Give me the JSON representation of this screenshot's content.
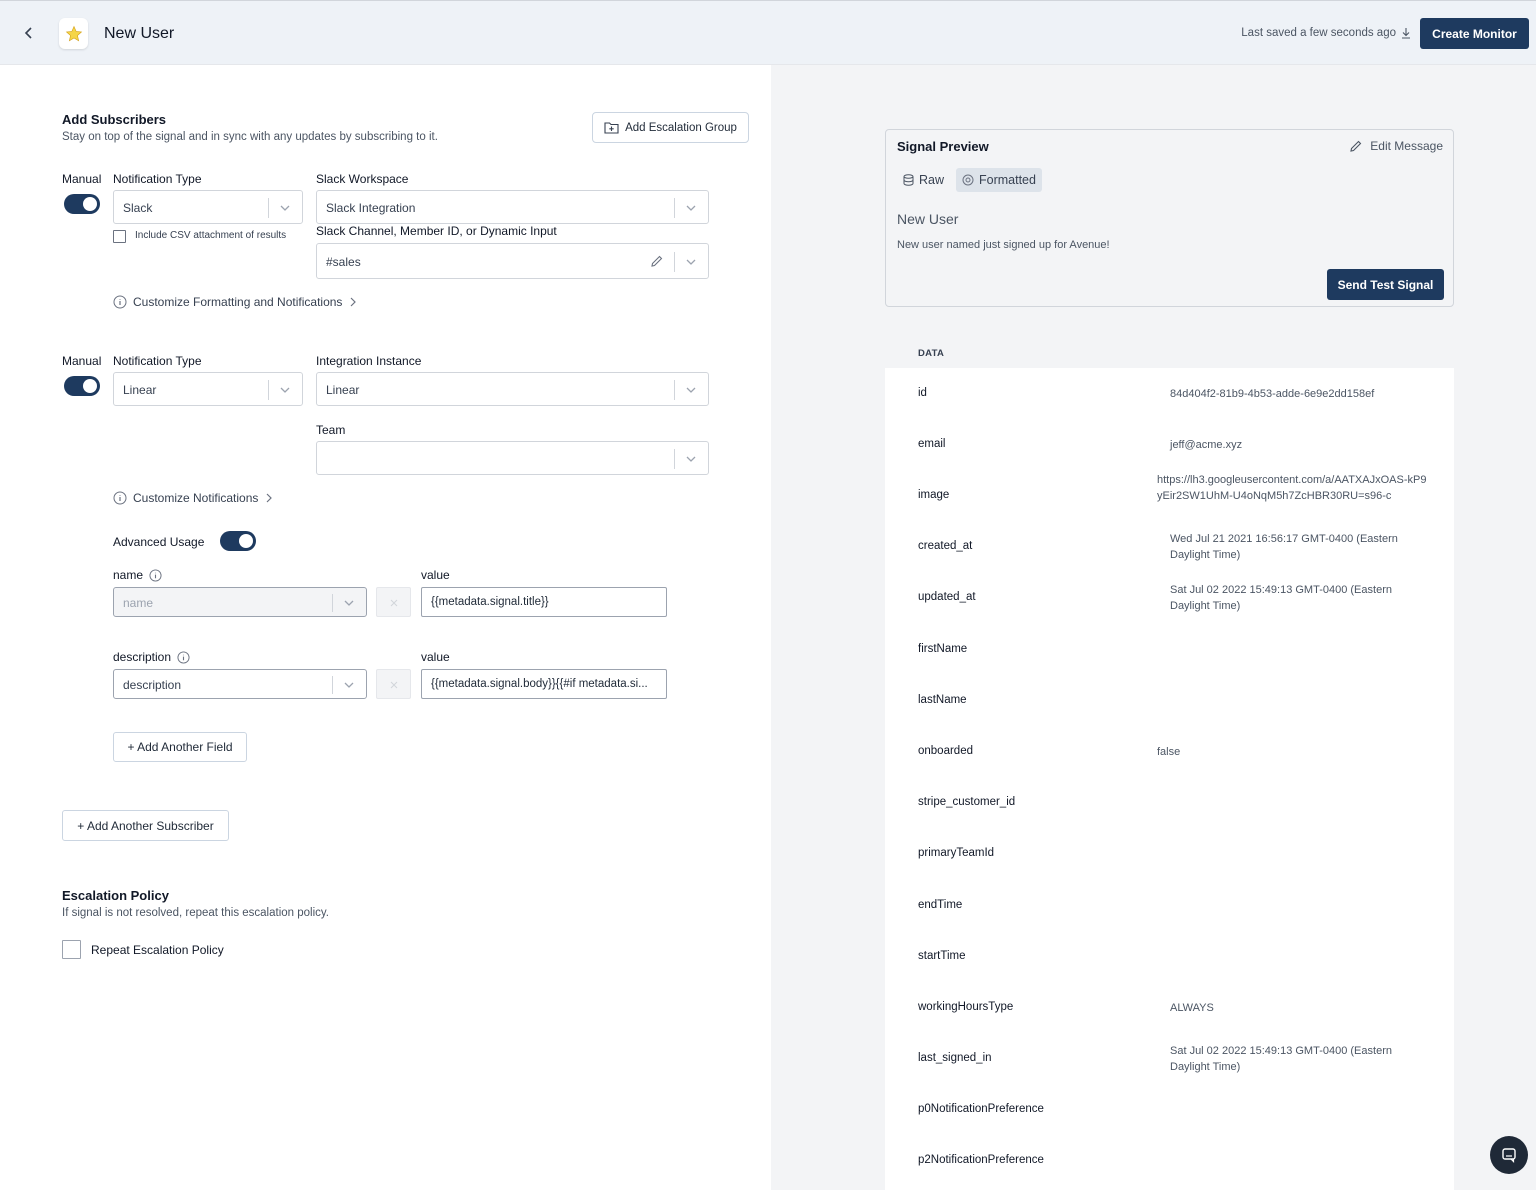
{
  "header": {
    "title": "New User",
    "saved_text": "Last saved a few seconds ago",
    "create_label": "Create Monitor"
  },
  "subscribers": {
    "title": "Add Subscribers",
    "subtitle": "Stay on top of the signal and in sync with any updates by subscribing to it.",
    "escalation_group_label": "Add Escalation Group",
    "slack": {
      "manual_label": "Manual",
      "notif_type_label": "Notification Type",
      "notif_type_value": "Slack",
      "workspace_label": "Slack Workspace",
      "workspace_value": "Slack Integration",
      "csv_label": "Include CSV attachment of results",
      "channel_label": "Slack Channel, Member ID, or Dynamic Input",
      "channel_value": "#sales",
      "customize_label": "Customize Formatting and Notifications"
    },
    "linear": {
      "manual_label": "Manual",
      "notif_type_label": "Notification Type",
      "notif_type_value": "Linear",
      "instance_label": "Integration Instance",
      "instance_value": "Linear",
      "team_label": "Team",
      "team_value": "",
      "customize_label": "Customize Notifications",
      "advanced_label": "Advanced Usage",
      "fields": [
        {
          "name_label": "name",
          "name_value": "name",
          "value_label": "value",
          "value": "{{metadata.signal.title}}"
        },
        {
          "name_label": "description",
          "name_value": "description",
          "value_label": "value",
          "value": "{{metadata.signal.body}}{{#if metadata.si..."
        }
      ],
      "add_field_label": "+ Add Another Field"
    },
    "add_subscriber_label": "+ Add Another Subscriber"
  },
  "escalation": {
    "title": "Escalation Policy",
    "subtitle": "If signal is not resolved, repeat this escalation policy.",
    "repeat_label": "Repeat Escalation Policy"
  },
  "preview": {
    "title": "Signal Preview",
    "edit_label": "Edit Message",
    "tab_raw": "Raw",
    "tab_formatted": "Formatted",
    "signal_title": "New User",
    "signal_body": "New user named just signed up for Avenue!",
    "send_label": "Send Test Signal"
  },
  "data": {
    "header": "DATA",
    "rows": [
      {
        "key": "id",
        "value": "84d404f2-81b9-4b53-adde-6e9e2dd158ef"
      },
      {
        "key": "email",
        "value": "jeff@acme.xyz"
      },
      {
        "key": "image",
        "value": "https://lh3.googleusercontent.com/a/AATXAJxOAS-kP9yEir2SW1UhM-U4oNqM5h7ZcHBR30RU=s96-c"
      },
      {
        "key": "created_at",
        "value": "Wed Jul 21 2021 16:56:17 GMT-0400 (Eastern Daylight Time)"
      },
      {
        "key": "updated_at",
        "value": "Sat Jul 02 2022 15:49:13 GMT-0400 (Eastern Daylight Time)"
      },
      {
        "key": "firstName",
        "value": ""
      },
      {
        "key": "lastName",
        "value": ""
      },
      {
        "key": "onboarded",
        "value": "false"
      },
      {
        "key": "stripe_customer_id",
        "value": ""
      },
      {
        "key": "primaryTeamId",
        "value": ""
      },
      {
        "key": "endTime",
        "value": ""
      },
      {
        "key": "startTime",
        "value": ""
      },
      {
        "key": "workingHoursType",
        "value": "ALWAYS"
      },
      {
        "key": "last_signed_in",
        "value": "Sat Jul 02 2022 15:49:13 GMT-0400 (Eastern Daylight Time)"
      },
      {
        "key": "p0NotificationPreference",
        "value": ""
      },
      {
        "key": "p2NotificationPreference",
        "value": ""
      }
    ]
  },
  "colors": {
    "primary": "#1e3a5f",
    "header_bg": "#eef2f7",
    "panel_bg": "#f3f4f6"
  }
}
